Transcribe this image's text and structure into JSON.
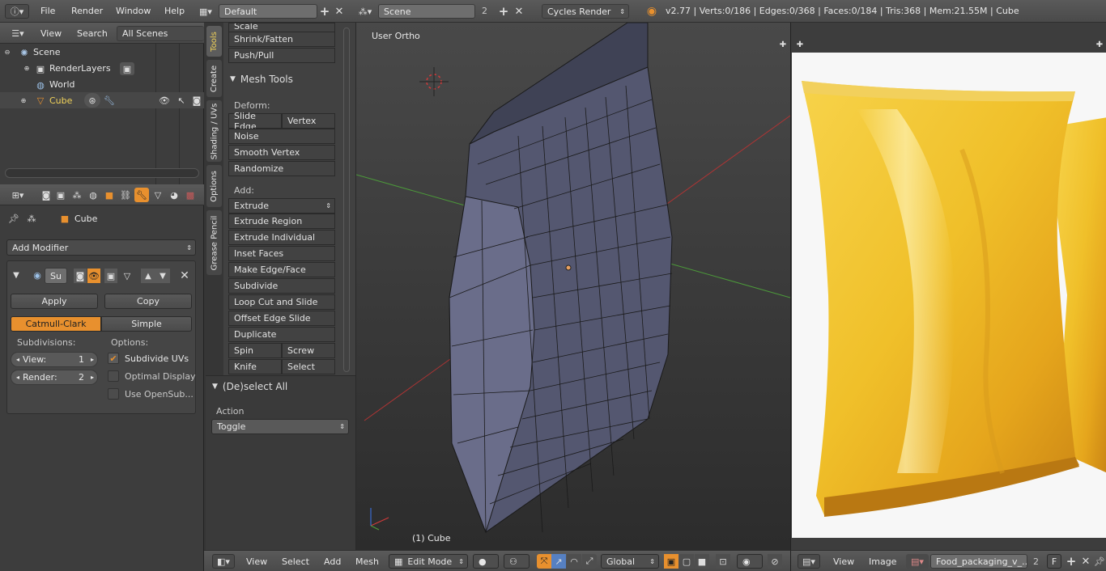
{
  "topbar": {
    "menus": [
      "File",
      "Render",
      "Window",
      "Help"
    ],
    "screen_layout": "Default",
    "scene": "Scene",
    "scene_users": "2",
    "engine": "Cycles Render",
    "stats": "v2.77 | Verts:0/186 | Edges:0/368 | Faces:0/184 | Tris:368 | Mem:21.55M | Cube"
  },
  "outliner": {
    "header": {
      "view": "View",
      "search": "Search",
      "filter": "All Scenes"
    },
    "items": [
      "Scene",
      "RenderLayers",
      "World",
      "Cube"
    ]
  },
  "properties": {
    "object_name": "Cube",
    "add_modifier": "Add Modifier",
    "modifier_name": "Su",
    "apply": "Apply",
    "copy": "Copy",
    "catmull": "Catmull-Clark",
    "simple": "Simple",
    "subdivisions_label": "Subdivisions:",
    "options_label": "Options:",
    "view_label": "View:",
    "view_value": "1",
    "render_label": "Render:",
    "render_value": "2",
    "subdivide_uvs": "Subdivide UVs",
    "subdivide_uvs_checked": true,
    "optimal_display": "Optimal Display",
    "optimal_display_checked": false,
    "use_opensub": "Use OpenSub...",
    "use_opensub_checked": false
  },
  "toolshelf": {
    "tabs": [
      "Tools",
      "Create",
      "Shading / UVs",
      "Options",
      "Grease Pencil"
    ],
    "top_items": [
      "Scale",
      "Shrink/Fatten",
      "Push/Pull"
    ],
    "mesh_tools_title": "Mesh Tools",
    "deform_label": "Deform:",
    "slide_edge": "Slide Edge",
    "vertex": "Vertex",
    "noise": "Noise",
    "smooth_vertex": "Smooth Vertex",
    "randomize": "Randomize",
    "add_label": "Add:",
    "extrude": "Extrude",
    "add_items": [
      "Extrude Region",
      "Extrude Individual",
      "Inset Faces",
      "Make Edge/Face",
      "Subdivide",
      "Loop Cut and Slide",
      "Offset Edge Slide",
      "Duplicate"
    ],
    "spin": "Spin",
    "screw": "Screw",
    "knife": "Knife",
    "select": "Select",
    "operator_title": "(De)select All",
    "action_label": "Action",
    "action_value": "Toggle"
  },
  "viewport": {
    "view_name": "User Ortho",
    "object_label": "(1) Cube",
    "header": {
      "view": "View",
      "select": "Select",
      "add": "Add",
      "mesh": "Mesh",
      "mode": "Edit Mode",
      "orientation": "Global"
    }
  },
  "image_editor": {
    "header": {
      "view": "View",
      "image": "Image",
      "image_name": "Food_packaging_v_...",
      "users": "2",
      "fake": "F"
    }
  },
  "colors": {
    "accent": "#e8902e",
    "selected_field": "#5680c2",
    "bag_yellow": "#f0c02a",
    "grid_x": "#b03434",
    "grid_y": "#4c9a3a"
  }
}
